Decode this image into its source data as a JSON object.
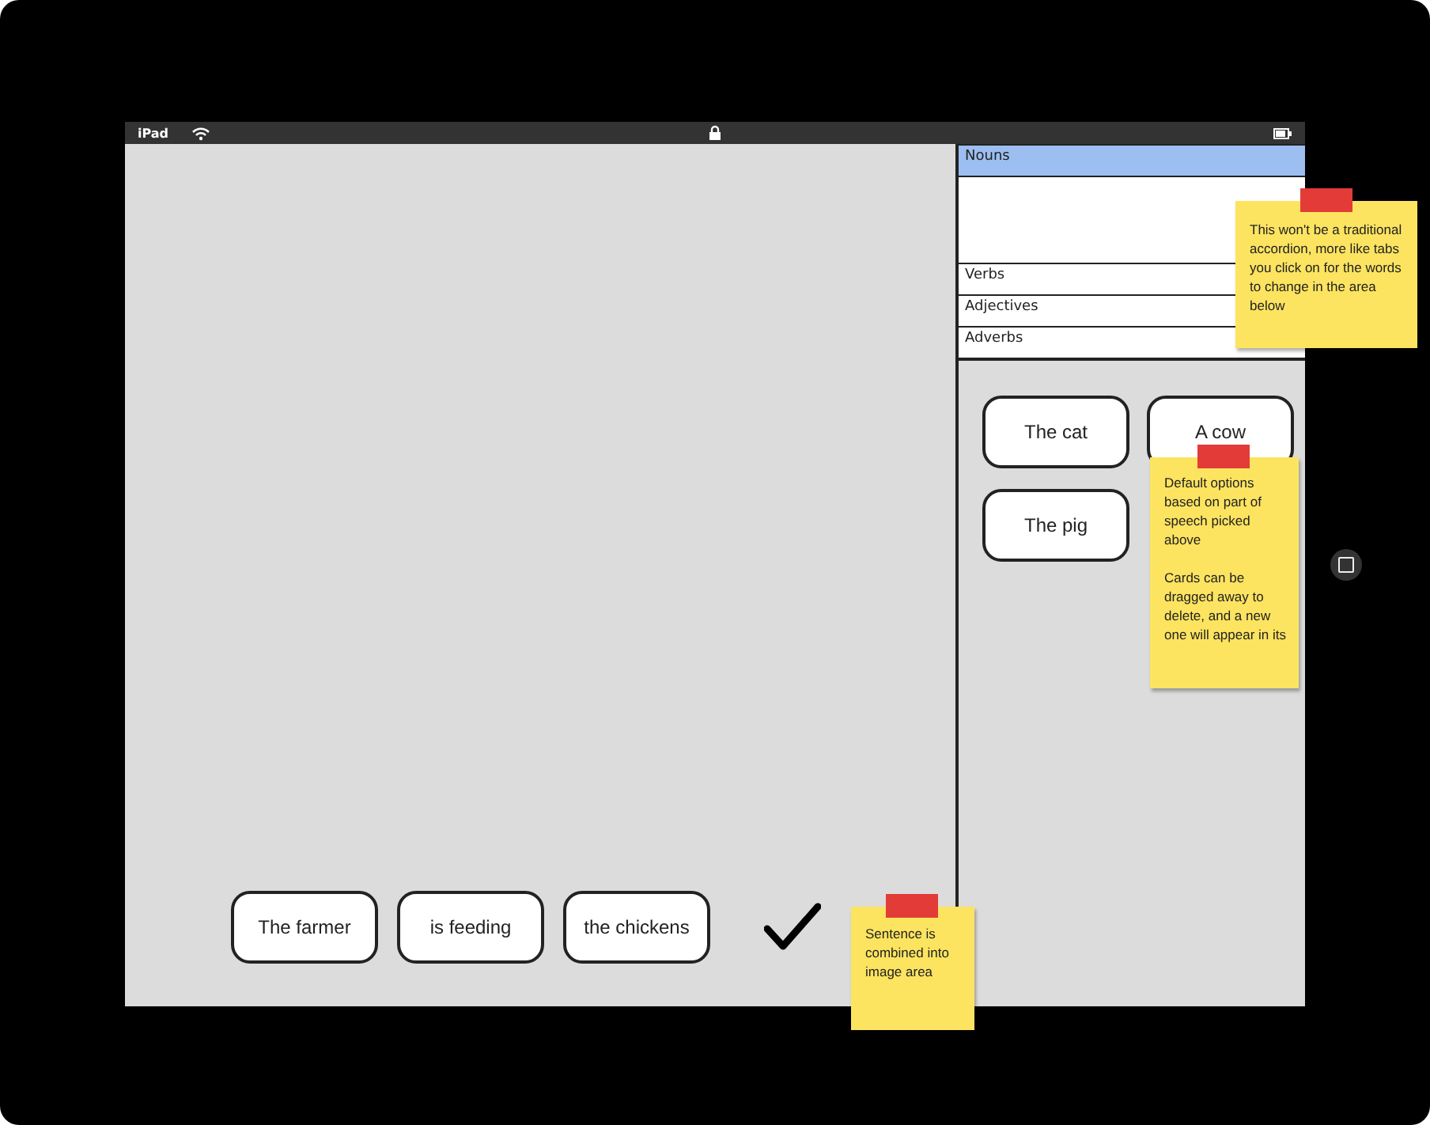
{
  "status_bar": {
    "device": "iPad"
  },
  "accordion": [
    {
      "label": "Nouns",
      "selected": true
    },
    {
      "label": "Verbs",
      "selected": false
    },
    {
      "label": "Adjectives",
      "selected": false
    },
    {
      "label": "Adverbs",
      "selected": false
    }
  ],
  "word_cards": [
    "The cat",
    "A cow",
    "The pig"
  ],
  "sentence_cards": [
    "The farmer",
    "is feeding",
    "the chickens"
  ],
  "sentence_checked": true,
  "notes": [
    {
      "paragraphs": [
        "This won't be a traditional accordion, more like tabs you click on for the words to change in the area below"
      ]
    },
    {
      "paragraphs": [
        "Default options based on part of speech picked above",
        "Cards can be dragged away to delete, and a new one will appear in its"
      ]
    },
    {
      "paragraphs": [
        "Sentence is combined into image area"
      ]
    }
  ]
}
